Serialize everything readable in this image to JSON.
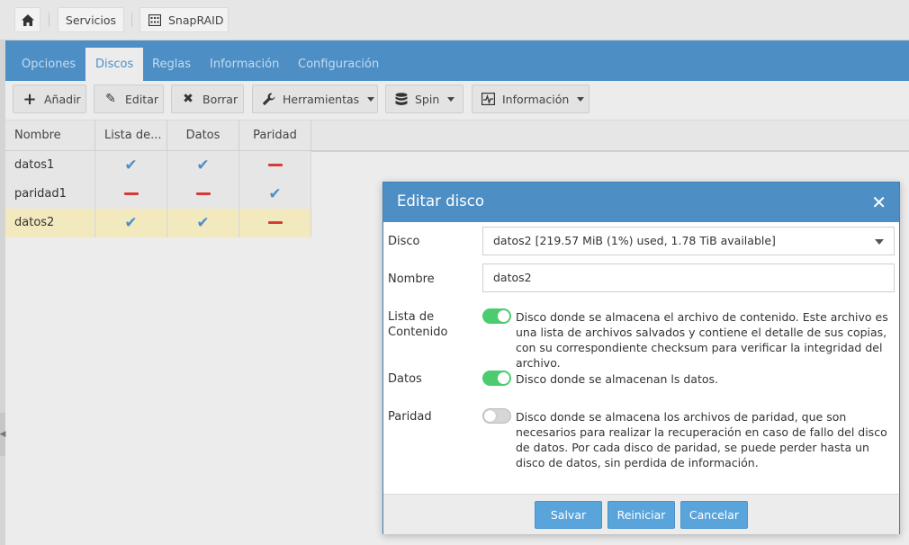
{
  "breadcrumb": {
    "home_icon": "home-icon",
    "items": [
      "Servicios",
      "SnapRAID"
    ]
  },
  "tabs": [
    {
      "label": "Opciones",
      "active": false
    },
    {
      "label": "Discos",
      "active": true
    },
    {
      "label": "Reglas",
      "active": false
    },
    {
      "label": "Información",
      "active": false
    },
    {
      "label": "Configuración",
      "active": false
    }
  ],
  "toolbar": {
    "add": "Añadir",
    "edit": "Editar",
    "delete": "Borrar",
    "tools": "Herramientas",
    "spin": "Spin",
    "info": "Información"
  },
  "grid": {
    "columns": [
      "Nombre",
      "Lista de...",
      "Datos",
      "Paridad"
    ],
    "rows": [
      {
        "name": "datos1",
        "content": true,
        "data": true,
        "parity": false,
        "selected": false
      },
      {
        "name": "paridad1",
        "content": false,
        "data": false,
        "parity": true,
        "selected": false
      },
      {
        "name": "datos2",
        "content": true,
        "data": true,
        "parity": false,
        "selected": true
      }
    ]
  },
  "dialog": {
    "title": "Editar disco",
    "disk_label": "Disco",
    "disk_value": "datos2 [219.57 MiB (1%) used, 1.78 TiB available]",
    "name_label": "Nombre",
    "name_value": "datos2",
    "content_label_1": "Lista de",
    "content_label_2": "Contenido",
    "content_on": true,
    "content_desc": "Disco donde se almacena el archivo de contenido. Este archivo es una lista de archivos salvados y contiene el detalle de sus copias, con su correspondiente checksum para verificar la integridad del archivo.",
    "data_label": "Datos",
    "data_on": true,
    "data_desc": "Disco donde se almacenan ls datos.",
    "parity_label": "Paridad",
    "parity_on": false,
    "parity_desc": "Disco donde se almacena los archivos de paridad, que son necesarios para realizar la recuperación en caso de fallo del disco de datos. Por cada disco de paridad, se puede perder hasta un disco de datos, sin perdida de información.",
    "save": "Salvar",
    "reset": "Reiniciar",
    "cancel": "Cancelar"
  },
  "colors": {
    "accent": "#4d8fc5",
    "toggle_on": "#4ccc6e",
    "check": "#4d8fc5",
    "dash": "#d63a3a",
    "selected_row": "#f3e9bf"
  }
}
